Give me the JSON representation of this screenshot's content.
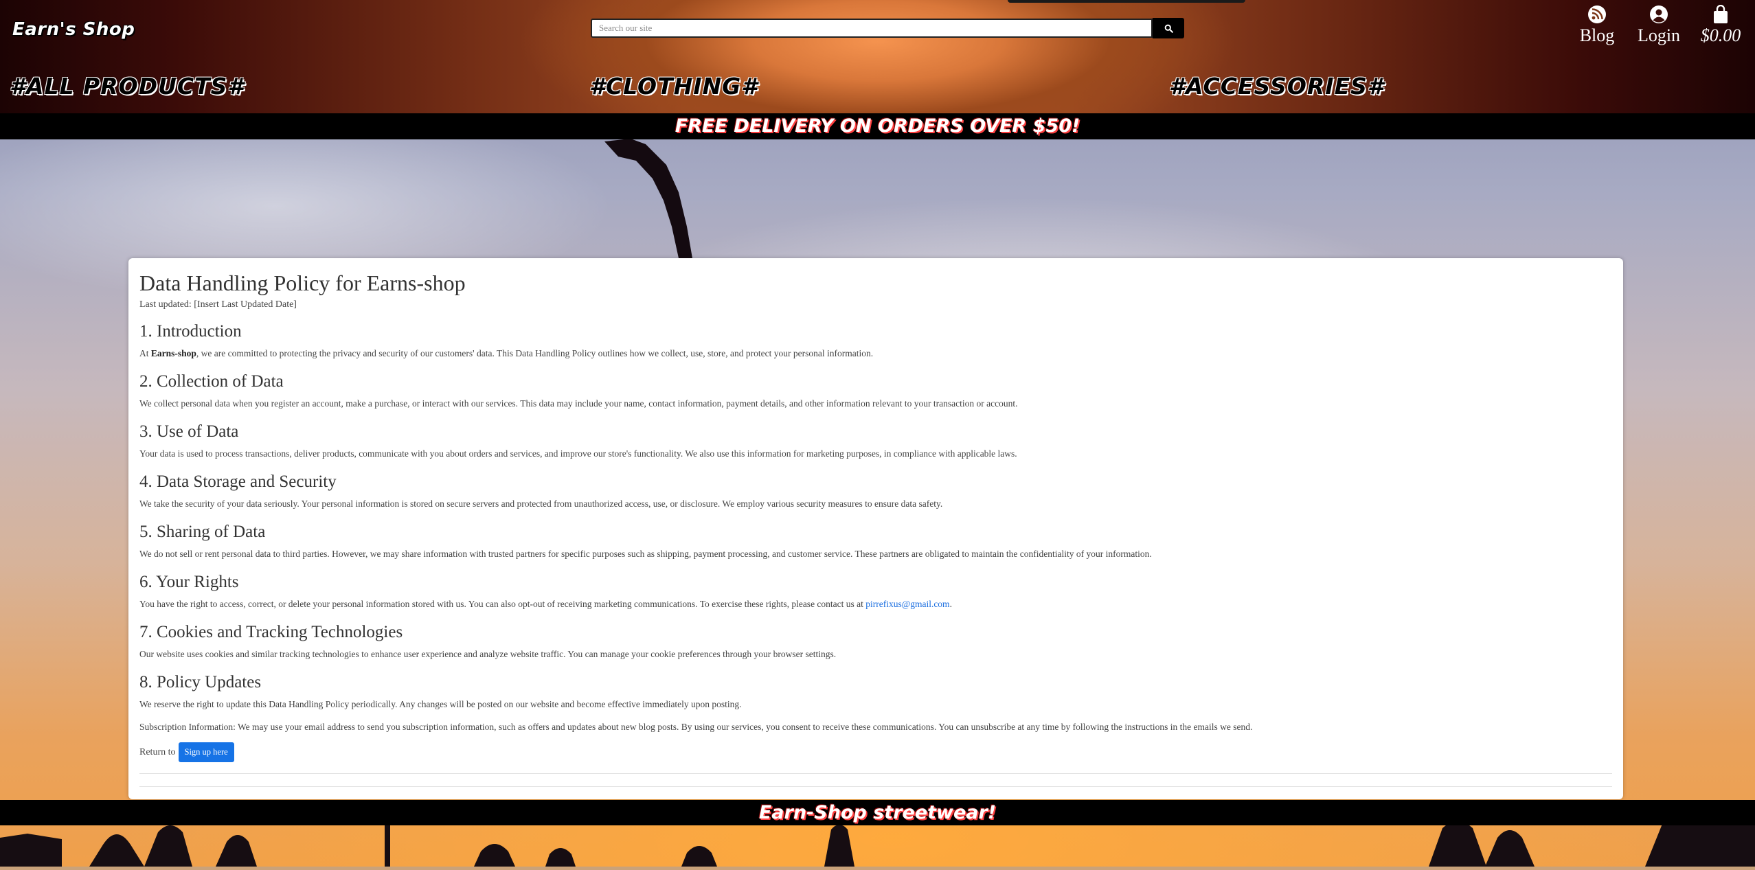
{
  "header": {
    "logo": "Earn's Shop",
    "search_placeholder": "Search our site",
    "nav": {
      "blog_label": "Blog",
      "login_label": "Login",
      "cart_total": "$0.00"
    },
    "categories": [
      "#ALL PRODUCTS#",
      "#CLOTHING#",
      "#ACCESSORIES#"
    ]
  },
  "promo_text": "FREE DELIVERY ON ORDERS OVER $50!",
  "policy": {
    "title": "Data Handling Policy for Earns-shop",
    "last_updated": "Last updated: [Insert Last Updated Date]",
    "sections": [
      {
        "heading": "1. Introduction",
        "text_before": "At ",
        "text_bold": "Earns-shop",
        "text_after": ", we are committed to protecting the privacy and security of our customers' data. This Data Handling Policy outlines how we collect, use, store, and protect your personal information."
      },
      {
        "heading": "2. Collection of Data",
        "text": "We collect personal data when you register an account, make a purchase, or interact with our services. This data may include your name, contact information, payment details, and other information relevant to your transaction or account."
      },
      {
        "heading": "3. Use of Data",
        "text": "Your data is used to process transactions, deliver products, communicate with you about orders and services, and improve our store's functionality. We also use this information for marketing purposes, in compliance with applicable laws."
      },
      {
        "heading": "4. Data Storage and Security",
        "text": "We take the security of your data seriously. Your personal information is stored on secure servers and protected from unauthorized access, use, or disclosure. We employ various security measures to ensure data safety."
      },
      {
        "heading": "5. Sharing of Data",
        "text": "We do not sell or rent personal data to third parties. However, we may share information with trusted partners for specific purposes such as shipping, payment processing, and customer service. These partners are obligated to maintain the confidentiality of your information."
      },
      {
        "heading": "6. Your Rights",
        "text": "You have the right to access, correct, or delete your personal information stored with us. You can also opt-out of receiving marketing communications. To exercise these rights, please contact us at ",
        "email": "pirrefixus@gmail.com",
        "text_end": "."
      },
      {
        "heading": "7. Cookies and Tracking Technologies",
        "text": "Our website uses cookies and similar tracking technologies to enhance user experience and analyze website traffic. You can manage your cookie preferences through your browser settings."
      },
      {
        "heading": "8. Policy Updates",
        "text": "We reserve the right to update this Data Handling Policy periodically. Any changes will be posted on our website and become effective immediately upon posting."
      }
    ],
    "subscription_info": "Subscription Information: We may use your email address to send you subscription information, such as offers and updates about new blog posts. By using our services, you consent to receive these communications. You can unsubscribe at any time by following the instructions in the emails we send.",
    "return_label": "Return to",
    "signup_button": "Sign up here"
  },
  "footer_text": "Earn-Shop streetwear!",
  "colors": {
    "link": "#1a6ee0",
    "button": "#1673e6",
    "bar": "#000000"
  }
}
